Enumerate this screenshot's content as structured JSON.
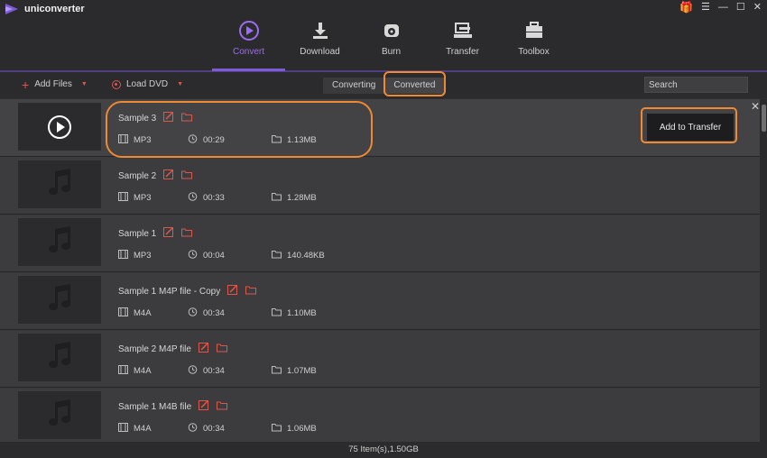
{
  "app": {
    "name": "uniconverter"
  },
  "window_controls": [
    "gift",
    "menu",
    "minimize",
    "maximize",
    "close"
  ],
  "nav": [
    {
      "label": "Convert",
      "icon": "convert-icon",
      "active": true
    },
    {
      "label": "Download",
      "icon": "download-icon",
      "active": false
    },
    {
      "label": "Burn",
      "icon": "burn-icon",
      "active": false
    },
    {
      "label": "Transfer",
      "icon": "transfer-icon",
      "active": false
    },
    {
      "label": "Toolbox",
      "icon": "toolbox-icon",
      "active": false
    }
  ],
  "toolbar": {
    "add_files": "Add Files",
    "load_dvd": "Load DVD",
    "tabs": [
      "Converting",
      "Converted"
    ],
    "active_tab": "Converted",
    "search_placeholder": "Search"
  },
  "files": [
    {
      "name": "Sample 3",
      "format": "MP3",
      "duration": "00:29",
      "size": "1.13MB",
      "selected": true
    },
    {
      "name": "Sample 2",
      "format": "MP3",
      "duration": "00:33",
      "size": "1.28MB"
    },
    {
      "name": "Sample 1",
      "format": "MP3",
      "duration": "00:04",
      "size": "140.48KB"
    },
    {
      "name": "Sample 1 M4P file - Copy",
      "format": "M4A",
      "duration": "00:34",
      "size": "1.10MB"
    },
    {
      "name": "Sample 2 M4P file",
      "format": "M4A",
      "duration": "00:34",
      "size": "1.07MB"
    },
    {
      "name": "Sample 1 M4B file",
      "format": "M4A",
      "duration": "00:34",
      "size": "1.06MB"
    }
  ],
  "row_action": {
    "label": "Add to Transfer"
  },
  "status": {
    "text": "75 Item(s),1.50GB"
  },
  "colors": {
    "accent": "#7e5bd6",
    "icon_red": "#e0574a",
    "highlight": "#ef8a32"
  }
}
